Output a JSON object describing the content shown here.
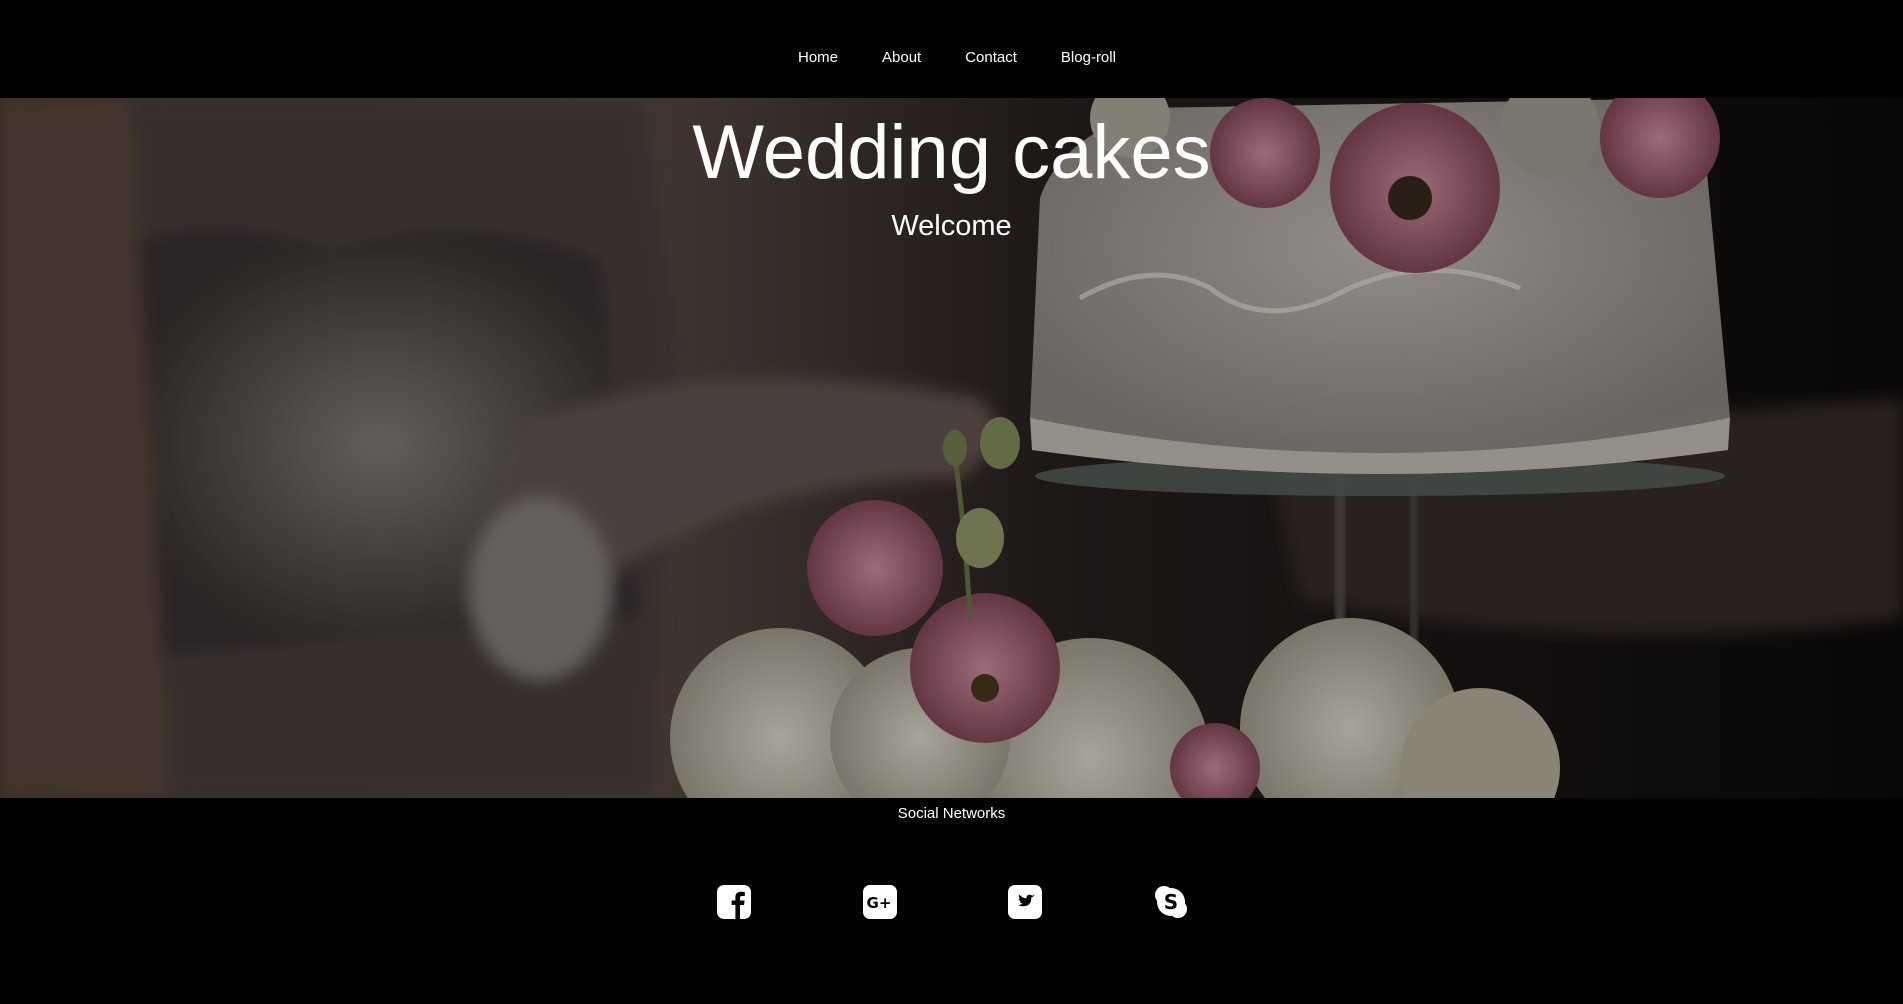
{
  "nav": {
    "items": [
      {
        "label": "Home"
      },
      {
        "label": "About"
      },
      {
        "label": "Contact"
      },
      {
        "label": "Blog-roll"
      }
    ]
  },
  "hero": {
    "title": "Wedding cakes",
    "subtitle": "Welcome",
    "image_description_icon": "wedding-cake-photo"
  },
  "footer": {
    "title": "Social Networks",
    "social": [
      {
        "icon": "facebook-icon"
      },
      {
        "icon": "google-plus-icon"
      },
      {
        "icon": "twitter-icon"
      },
      {
        "icon": "skype-icon"
      }
    ]
  },
  "colors": {
    "background": "#030303",
    "text": "#ffffff"
  }
}
